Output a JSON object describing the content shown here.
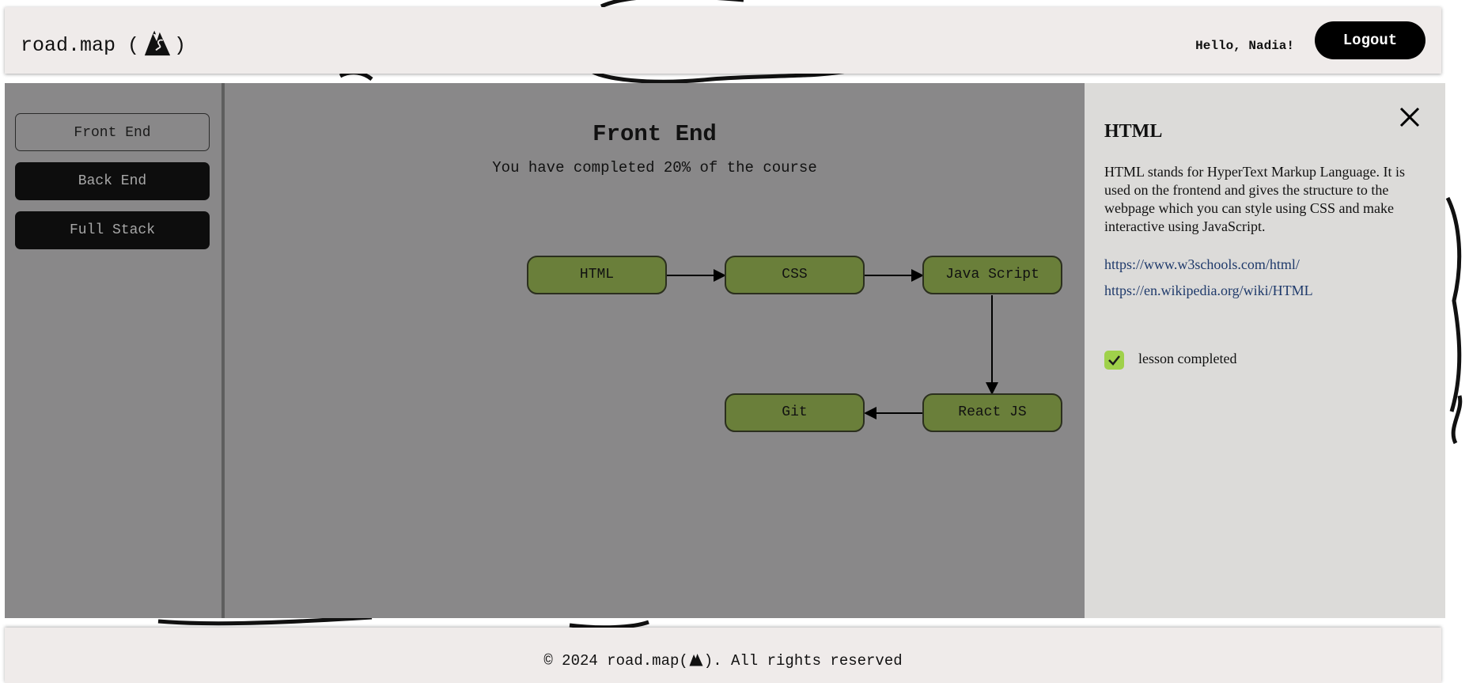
{
  "header": {
    "logo_text_prefix": "road.map (",
    "logo_text_suffix": ")",
    "greeting": "Hello, Nadia!",
    "logout_label": "Logout"
  },
  "sidebar": {
    "items": [
      {
        "label": "Front End",
        "active": true
      },
      {
        "label": "Back End",
        "active": false
      },
      {
        "label": "Full Stack",
        "active": false
      }
    ]
  },
  "roadmap": {
    "title": "Front End",
    "progress_text": "You have completed 20% of the course",
    "progress_percent": 20,
    "nodes": [
      "HTML",
      "CSS",
      "Java Script",
      "React JS",
      "Git"
    ],
    "node_color": "#6a7f3a"
  },
  "detail": {
    "title": "HTML",
    "description": "HTML stands for HyperText Markup Language. It is used on the frontend and gives the structure to the webpage which you can style using CSS and make interactive using JavaScript.",
    "links": [
      "https://www.w3schools.com/html/",
      "https://en.wikipedia.org/wiki/HTML"
    ],
    "completed_label": "lesson completed",
    "completed": true
  },
  "footer": {
    "copyright_prefix": "© 2024 road.map(",
    "copyright_suffix": "). All rights reserved"
  },
  "colors": {
    "accent_green": "#6a7f3a",
    "check_green": "#9fd14a",
    "link_blue": "#1f3a6b"
  }
}
